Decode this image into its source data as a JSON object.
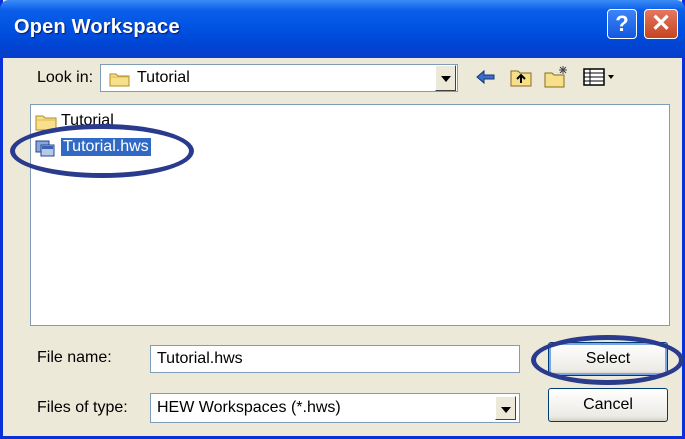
{
  "window": {
    "title": "Open Workspace",
    "help_label": "?",
    "close_label": "✕"
  },
  "toolbar": {
    "look_in_label": "Look in:",
    "look_in_value": "Tutorial",
    "icons": [
      "back-arrow-icon",
      "up-one-level-icon",
      "new-folder-icon",
      "view-menu-icon"
    ]
  },
  "file_list": {
    "items": [
      {
        "name": "Tutorial",
        "type": "folder"
      },
      {
        "name": "Tutorial.hws",
        "type": "workspace-file",
        "selected": true
      }
    ]
  },
  "form": {
    "file_name_label": "File name:",
    "file_name_value": "Tutorial.hws",
    "file_type_label": "Files of type:",
    "file_type_value": "HEW Workspaces (*.hws)"
  },
  "buttons": {
    "select_label": "Select",
    "cancel_label": "Cancel"
  },
  "colors": {
    "titlebar": "#0054e3",
    "selection": "#316ac5",
    "annotation": "#2a3a8c"
  }
}
